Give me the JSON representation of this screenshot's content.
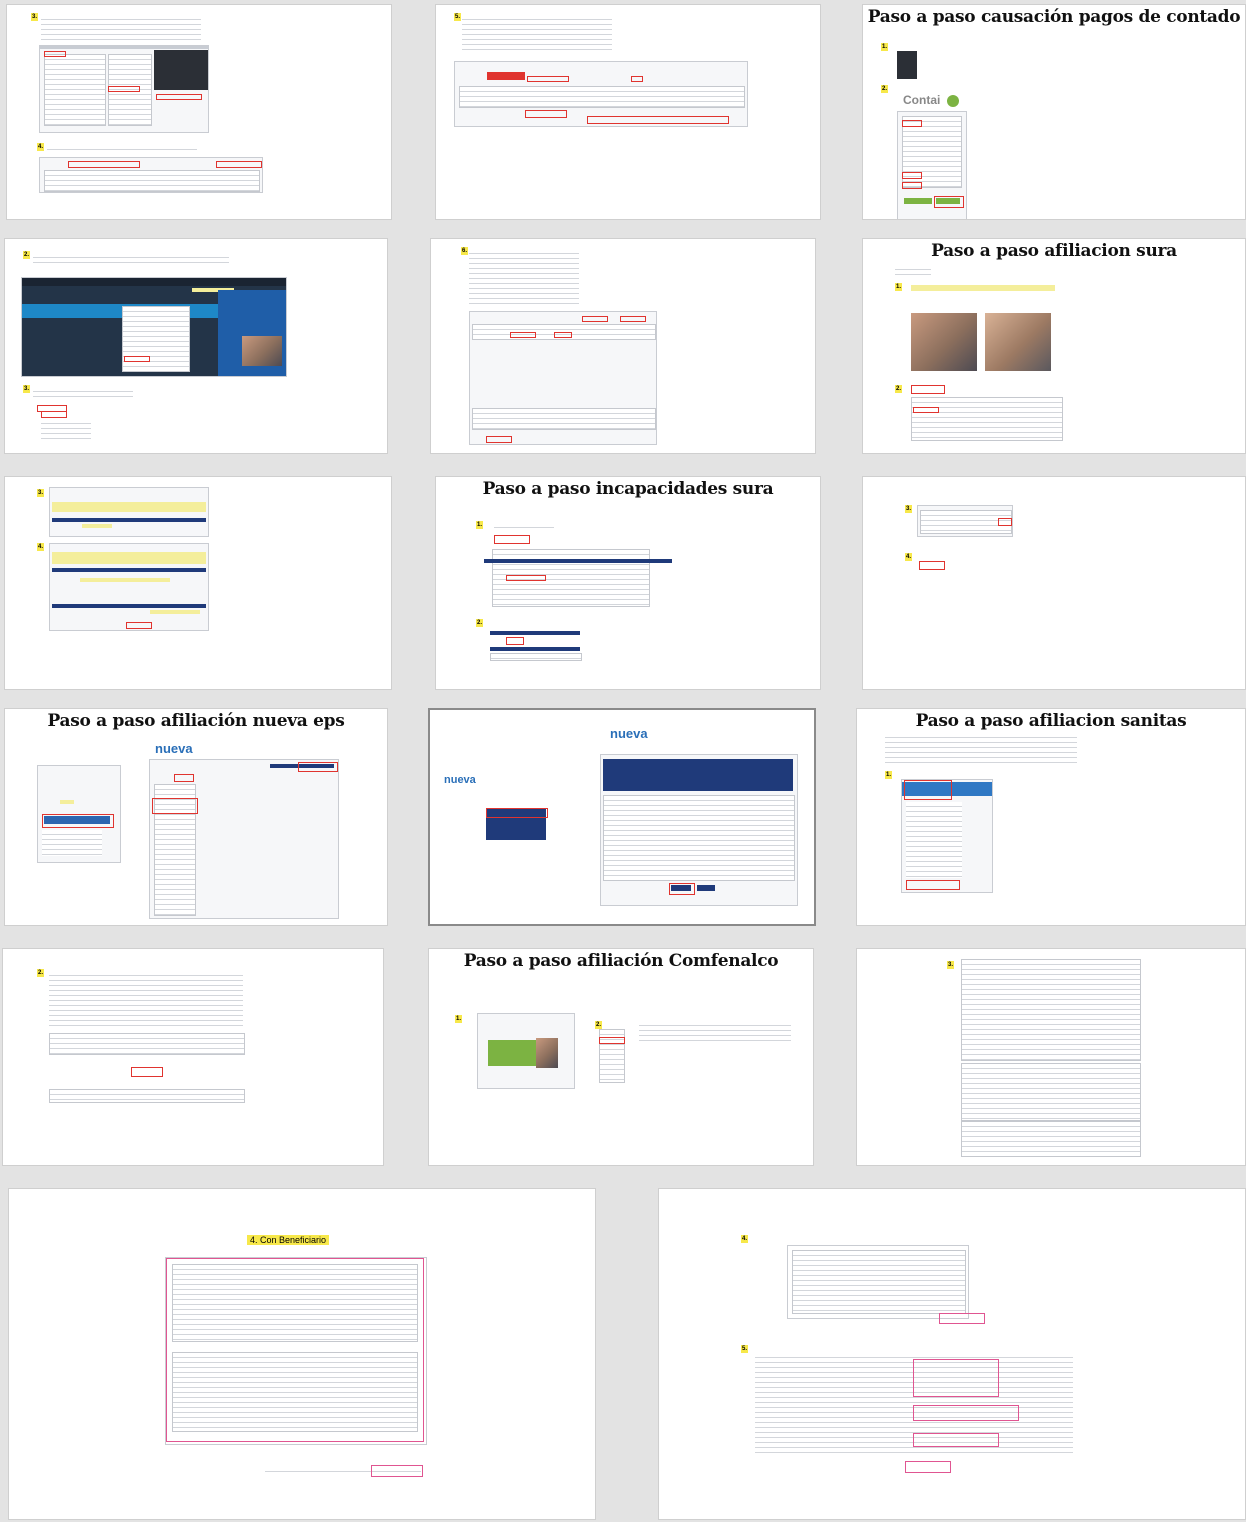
{
  "slides": {
    "causacion_title": "Paso a paso causación pagos de contado",
    "sura_afiliacion_title": "Paso a paso afiliacion sura",
    "sura_incapacidades_title": "Paso a paso incapacidades sura",
    "nueva_eps_title": "Paso a paso afiliación nueva eps",
    "sanitas_title": "Paso a paso afiliacion sanitas",
    "comfenalco_title": "Paso a paso afiliación Comfenalco",
    "beneficiario_badge": "4. Con Beneficiario"
  },
  "logos": {
    "contai": "Contai",
    "nueva": "nueva"
  },
  "step_numbers": [
    "1.",
    "2.",
    "3.",
    "4.",
    "5.",
    "6."
  ],
  "colors": {
    "highlight_yellow": "#f7e84a",
    "callout_red": "#e0342f",
    "callout_pink": "#e05591",
    "navy": "#1f3a7a"
  }
}
